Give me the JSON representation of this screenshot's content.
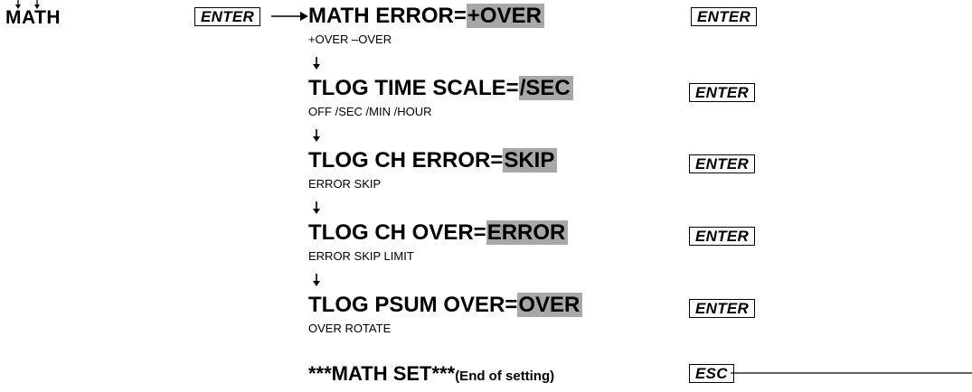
{
  "menu": {
    "label": "MATH",
    "enter_key": "ENTER"
  },
  "settings": [
    {
      "prefix": "MATH ERROR=",
      "value": "+OVER",
      "options": "+OVER –OVER",
      "key": "ENTER"
    },
    {
      "prefix": "TLOG TIME SCALE=",
      "value": "/SEC",
      "options": "OFF /SEC /MIN /HOUR",
      "key": "ENTER"
    },
    {
      "prefix": "TLOG CH ERROR=",
      "value": "SKIP",
      "options": "ERROR SKIP",
      "key": "ENTER"
    },
    {
      "prefix": "TLOG CH OVER=",
      "value": "ERROR",
      "options": "ERROR SKIP LIMIT",
      "key": "ENTER"
    },
    {
      "prefix": "TLOG PSUM OVER=",
      "value": "OVER",
      "options": "OVER ROTATE",
      "key": "ENTER"
    }
  ],
  "end": {
    "title": "***MATH SET***",
    "note": "(End of setting)",
    "key": "ESC"
  },
  "colors": {
    "highlight": "#a8a8a8",
    "text": "#000000"
  }
}
